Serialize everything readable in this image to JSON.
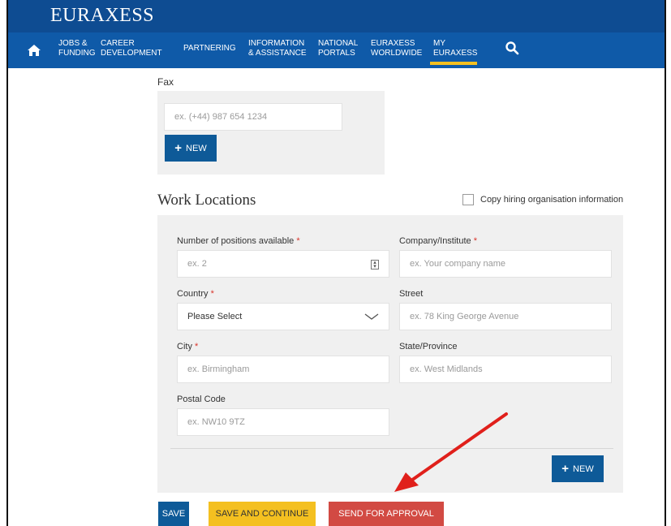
{
  "brand": "EURAXESS",
  "nav": {
    "items": [
      {
        "line1": "JOBS &",
        "line2": "FUNDING"
      },
      {
        "line1": "CAREER",
        "line2": "DEVELOPMENT"
      },
      {
        "line1": "PARTNERING",
        "line2": ""
      },
      {
        "line1": "INFORMATION",
        "line2": "& ASSISTANCE"
      },
      {
        "line1": "NATIONAL",
        "line2": "PORTALS"
      },
      {
        "line1": "EURAXESS",
        "line2": "WORLDWIDE"
      },
      {
        "line1": "MY",
        "line2": "EURAXESS"
      }
    ],
    "active_index": 6,
    "home_icon": "home-icon",
    "search_icon": "search-icon"
  },
  "fax": {
    "label": "Fax",
    "placeholder": "ex. (+44) 987 654 1234",
    "new_label": "NEW"
  },
  "work_locations": {
    "title": "Work Locations",
    "copy_checkbox_label": "Copy hiring organisation information",
    "positions": {
      "label": "Number of positions available",
      "placeholder": "ex. 2"
    },
    "company": {
      "label": "Company/Institute",
      "placeholder": "ex. Your company name"
    },
    "country": {
      "label": "Country",
      "value": "Please Select"
    },
    "street": {
      "label": "Street",
      "placeholder": "ex. 78 King George Avenue"
    },
    "city": {
      "label": "City",
      "placeholder": "ex. Birmingham"
    },
    "state": {
      "label": "State/Province",
      "placeholder": "ex. West Midlands"
    },
    "postal": {
      "label": "Postal Code",
      "placeholder": "ex. NW10 9TZ"
    },
    "new_label": "NEW",
    "required_mark": "*"
  },
  "actions": {
    "save": "SAVE",
    "save_continue": "SAVE AND CONTINUE",
    "send_approval": "SEND FOR APPROVAL"
  },
  "colors": {
    "header": "#0e4c92",
    "nav": "#0f5aa8",
    "primary_button": "#0e5a98",
    "accent_yellow": "#f4c020",
    "approval_red": "#d24a43",
    "annotation_arrow": "#e0201b"
  }
}
